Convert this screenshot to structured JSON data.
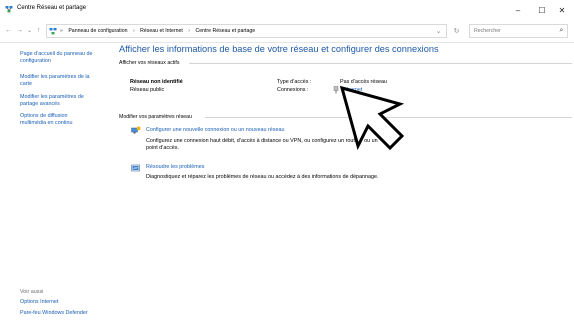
{
  "window": {
    "title": "Centre Réseau et partage",
    "minimize": "–",
    "maximize": "☐",
    "close": "✕"
  },
  "nav": {
    "back": "←",
    "forward": "→",
    "recent": "⌄",
    "up": "↑",
    "dropdown": "⌄",
    "refresh": "↻"
  },
  "breadcrumb": [
    "Panneau de configuration",
    "Réseau et Internet",
    "Centre Réseau et partage"
  ],
  "breadcrumb_sep": "›",
  "breadcrumb_lead": "»",
  "search": {
    "placeholder": "Rechercher",
    "icon": "⌕"
  },
  "sidebar": {
    "links": [
      {
        "lines": [
          "Page d’accueil du panneau de",
          "configuration"
        ]
      },
      {
        "lines": [
          "Modifier les paramètres de la",
          "carte"
        ]
      },
      {
        "lines": [
          "Modifier les paramètres de",
          "partage avancés"
        ]
      },
      {
        "lines": [
          "Options de diffusion",
          "multimédia en continu"
        ]
      }
    ],
    "see_also_title": "Voir aussi",
    "see_also": [
      "Options Internet",
      "Pare-feu Windows Defender"
    ]
  },
  "main": {
    "heading": "Afficher les informations de base de votre réseau et configurer des connexions",
    "active_label": "Afficher vos réseaux actifs",
    "network": {
      "name": "Réseau non identifié",
      "type": "Réseau public",
      "access_label": "Type d’accès :",
      "access_value": "Pas d’accès réseau",
      "connections_label": "Connexions :",
      "connection_link": "Ethernet"
    },
    "change_label": "Modifier vos paramètres réseau",
    "tasks": [
      {
        "title": "Configurer une nouvelle connexion ou un nouveau réseau",
        "desc_lines": [
          "Configurez une connexion haut débit, d’accès à distance ou VPN, ou configurez un routeur ou un",
          "point d’accès."
        ]
      },
      {
        "title": "Résoudre les problèmes",
        "desc_lines": [
          "Diagnostiquez et réparez les problèmes de réseau ou accédez à des informations de dépannage."
        ]
      }
    ]
  },
  "colors": {
    "link": "#1a5fb4",
    "heading": "#1e5aa8"
  }
}
